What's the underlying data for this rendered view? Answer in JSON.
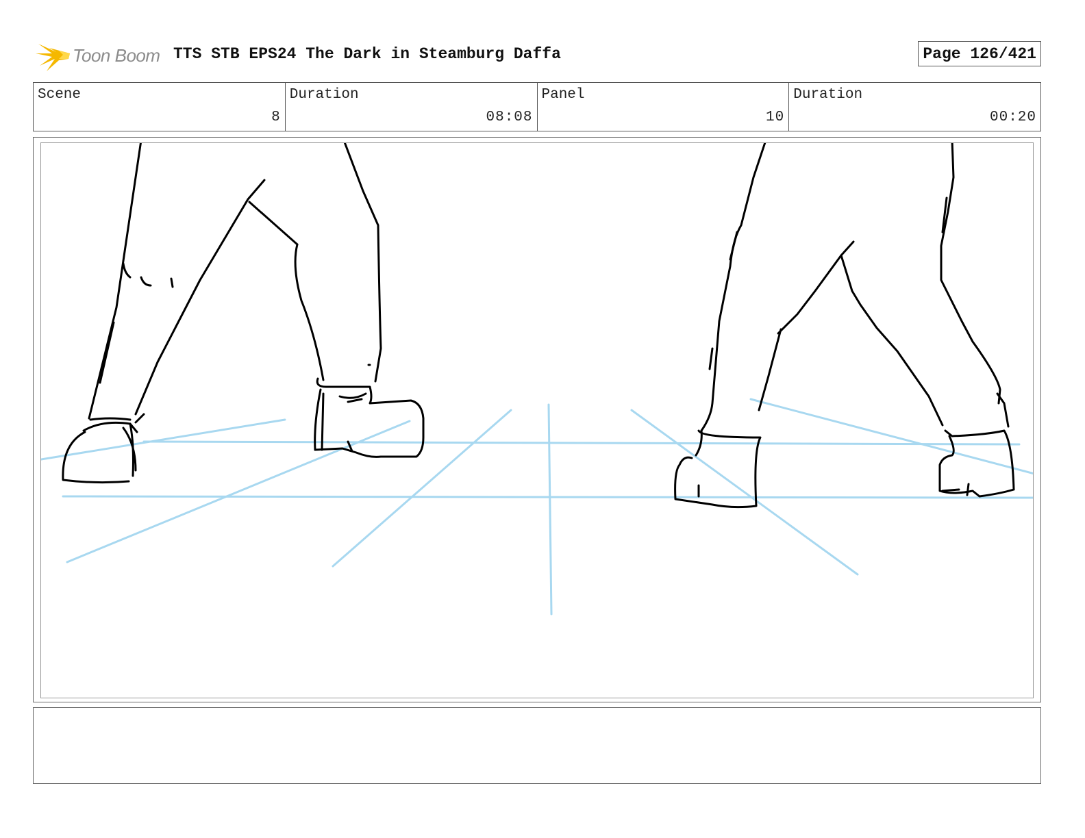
{
  "header": {
    "logo_text": "Toon Boom",
    "title": "TTS STB EPS24 The Dark in Steamburg Daffa",
    "page": "Page 126/421"
  },
  "info": {
    "scene_label": "Scene",
    "scene_value": "8",
    "scene_duration_label": "Duration",
    "scene_duration_value": "08:08",
    "panel_label": "Panel",
    "panel_value": "10",
    "panel_duration_label": "Duration",
    "panel_duration_value": "00:20"
  },
  "colors": {
    "guide_lines": "#a8d8f0",
    "ink": "#000000",
    "logo_flame": "#f5b800"
  },
  "panel": {
    "illustration": "sketch-legs-walking"
  },
  "notes": {
    "text": ""
  }
}
